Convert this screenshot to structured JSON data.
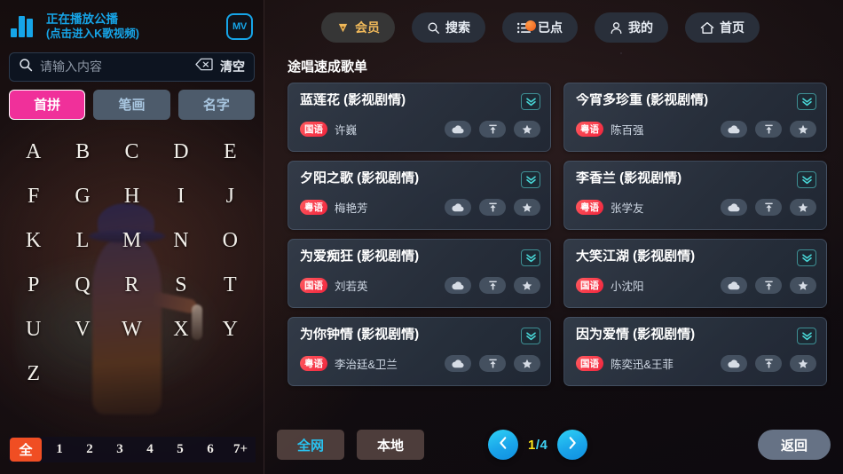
{
  "left": {
    "now_playing": {
      "line1": "正在播放公播",
      "line2": "(点击进入K歌视频)",
      "eq_icon": "equalizer-icon",
      "mv_label": "MV"
    },
    "search": {
      "placeholder": "请输入内容",
      "value": "",
      "search_icon": "search-icon",
      "backspace_icon": "backspace-icon",
      "clear_label": "清空"
    },
    "mode_tabs": [
      {
        "label": "首拼",
        "active": true
      },
      {
        "label": "笔画",
        "active": false
      },
      {
        "label": "名字",
        "active": false
      }
    ],
    "letters": [
      "A",
      "B",
      "C",
      "D",
      "E",
      "F",
      "G",
      "H",
      "I",
      "J",
      "K",
      "L",
      "M",
      "N",
      "O",
      "P",
      "Q",
      "R",
      "S",
      "T",
      "U",
      "V",
      "W",
      "X",
      "Y",
      "Z"
    ],
    "numbers": [
      {
        "label": "全",
        "active": true
      },
      {
        "label": "1",
        "active": false
      },
      {
        "label": "2",
        "active": false
      },
      {
        "label": "3",
        "active": false
      },
      {
        "label": "4",
        "active": false
      },
      {
        "label": "5",
        "active": false
      },
      {
        "label": "6",
        "active": false
      },
      {
        "label": "7+",
        "active": false
      }
    ]
  },
  "topnav": [
    {
      "label": "会员",
      "icon": "diamond-icon",
      "style": "vip"
    },
    {
      "label": "搜索",
      "icon": "search-icon",
      "style": "normal"
    },
    {
      "label": "已点",
      "icon": "playlist-icon",
      "style": "normal",
      "badge": true
    },
    {
      "label": "我的",
      "icon": "user-icon",
      "style": "normal"
    },
    {
      "label": "首页",
      "icon": "home-icon",
      "style": "normal"
    }
  ],
  "main": {
    "section_title": "途唱速成歌单",
    "songs": [
      {
        "title": "蓝莲花 (影视剧情)",
        "lang": "国语",
        "artist": "许巍"
      },
      {
        "title": "今宵多珍重 (影视剧情)",
        "lang": "粤语",
        "artist": "陈百强"
      },
      {
        "title": "夕阳之歌 (影视剧情)",
        "lang": "粤语",
        "artist": "梅艳芳"
      },
      {
        "title": "李香兰 (影视剧情)",
        "lang": "粤语",
        "artist": "张学友"
      },
      {
        "title": "为爱痴狂 (影视剧情)",
        "lang": "国语",
        "artist": "刘若英"
      },
      {
        "title": "大笑江湖 (影视剧情)",
        "lang": "国语",
        "artist": "小沈阳"
      },
      {
        "title": "为你钟情 (影视剧情)",
        "lang": "粤语",
        "artist": "李治廷&卫兰"
      },
      {
        "title": "因为爱情 (影视剧情)",
        "lang": "国语",
        "artist": "陈奕迅&王菲"
      }
    ],
    "card_icons": {
      "expand": "chevron-double-down-icon",
      "download": "cloud-icon",
      "top": "pin-top-icon",
      "favorite": "star-icon"
    }
  },
  "bottom": {
    "sources": [
      {
        "label": "全网",
        "active": true
      },
      {
        "label": "本地",
        "active": false
      }
    ],
    "prev_icon": "chevron-left-icon",
    "next_icon": "chevron-right-icon",
    "page_current": "1",
    "page_separator": "/",
    "page_total": "4",
    "back_label": "返回"
  },
  "colors": {
    "accent_cyan": "#16a5e8",
    "accent_pink": "#f0309a",
    "accent_orange": "#f04e23",
    "vip_gold": "#f0b95a",
    "page_yellow": "#ffe81a",
    "lang_badge_red": "#f0243c"
  }
}
